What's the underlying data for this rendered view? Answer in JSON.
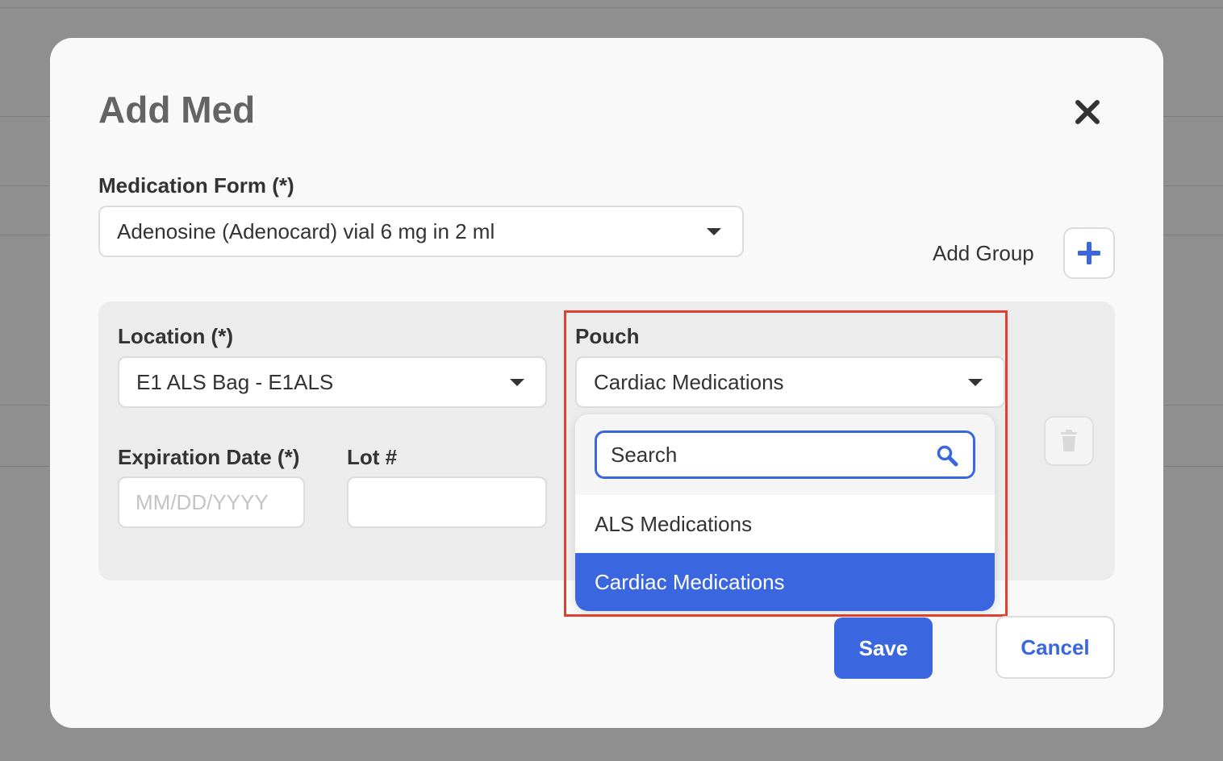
{
  "modal": {
    "title": "Add Med",
    "close_icon": "close-icon"
  },
  "medication_form": {
    "label": "Medication Form (*)",
    "value": "Adenosine (Adenocard) vial 6 mg in 2 ml"
  },
  "add_group": {
    "label": "Add Group",
    "icon": "plus-icon"
  },
  "group": {
    "location": {
      "label": "Location (*)",
      "value": "E1 ALS Bag - E1ALS"
    },
    "pouch": {
      "label": "Pouch",
      "value": "Cardiac Medications",
      "dropdown": {
        "search_placeholder": "Search",
        "options": [
          "ALS Medications",
          "Cardiac Medications"
        ],
        "selected": "Cardiac Medications"
      }
    },
    "expiration_date": {
      "label": "Expiration Date (*)",
      "placeholder": "MM/DD/YYYY",
      "value": ""
    },
    "lot": {
      "label": "Lot #",
      "value": ""
    },
    "delete_icon": "trash-icon"
  },
  "actions": {
    "save_label": "Save",
    "cancel_label": "Cancel"
  },
  "colors": {
    "accent": "#3a66e0",
    "highlight": "#e0412f",
    "title_text": "#646464"
  }
}
